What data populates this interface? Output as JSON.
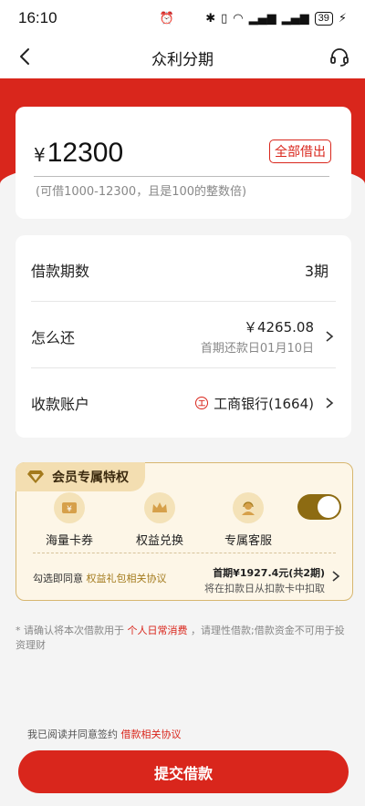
{
  "status_bar": {
    "time": "16:10",
    "battery": "39"
  },
  "nav": {
    "title": "众利分期"
  },
  "amount": {
    "currency": "¥",
    "value": "12300",
    "borrow_all": "全部借出",
    "hint": "(可借1000-12300，且是100的整数倍)"
  },
  "info": {
    "term_label": "借款期数",
    "term_value": "3期",
    "repay_label": "怎么还",
    "repay_amount": "￥4265.08",
    "repay_sub": "首期还款日01月10日",
    "account_label": "收款账户",
    "bank_name": "工商银行(1664)"
  },
  "member": {
    "title": "会员专属特权",
    "benefits": [
      {
        "label": "海量卡券",
        "icon": "coupon-icon"
      },
      {
        "label": "权益兑换",
        "icon": "crown-icon"
      },
      {
        "label": "专属客服",
        "icon": "support-agent-icon"
      }
    ],
    "toggle_on": true,
    "agree_prefix": "勾选即同意",
    "agree_link": "权益礼包相关协议",
    "first_amount": "首期¥1927.4元(共2期)",
    "first_sub": "将在扣款日从扣款卡中扣取"
  },
  "notice": {
    "prefix": "* 请确认将本次借款用于",
    "link": "个人日常消费",
    "suffix": "，请理性借款;借款资金不可用于投资理财"
  },
  "agreement": {
    "prefix": "我已阅读并同意签约",
    "link": "借款相关协议"
  },
  "submit_label": "提交借款",
  "colors": {
    "primary": "#d9261c",
    "gold": "#8d6b12",
    "member_bg": "#fdf6e7"
  }
}
